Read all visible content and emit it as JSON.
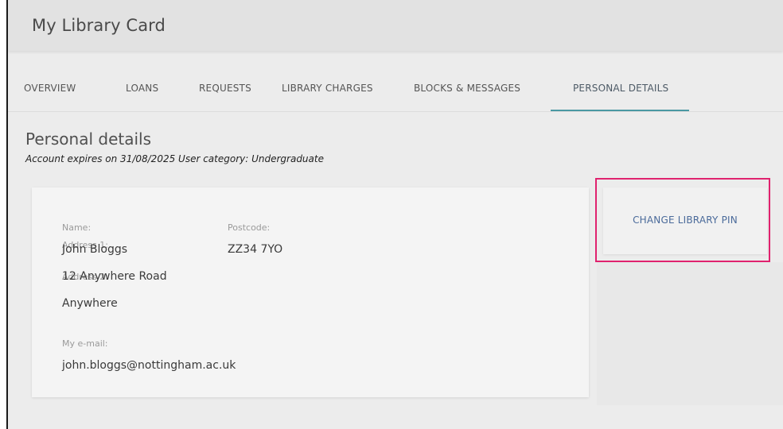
{
  "header": {
    "title": "My Library Card"
  },
  "tabs": [
    {
      "label": "OVERVIEW"
    },
    {
      "label": "LOANS"
    },
    {
      "label": "REQUESTS"
    },
    {
      "label": "LIBRARY CHARGES"
    },
    {
      "label": "BLOCKS & MESSAGES"
    },
    {
      "label": "PERSONAL DETAILS"
    }
  ],
  "active_tab": "PERSONAL DETAILS",
  "section": {
    "title": "Personal details",
    "account_info": "Account expires on 31/08/2025 User category: Undergraduate"
  },
  "details": {
    "name_label": "Name:",
    "name_value": "John Bloggs",
    "address1_label": "Address 1:",
    "address1_value": "12 Anywhere Road",
    "address2_label": "Address 2:",
    "address2_value": "Anywhere",
    "postcode_label": "Postcode:",
    "postcode_value": "ZZ34 7YO",
    "email_label": "My e-mail:",
    "email_value": "john.bloggs@nottingham.ac.uk"
  },
  "actions": {
    "change_pin_label": "CHANGE LIBRARY PIN"
  },
  "colors": {
    "highlight": "#e0226e",
    "active_tab_underline": "#4a98a2",
    "link": "#4a6a9a"
  }
}
